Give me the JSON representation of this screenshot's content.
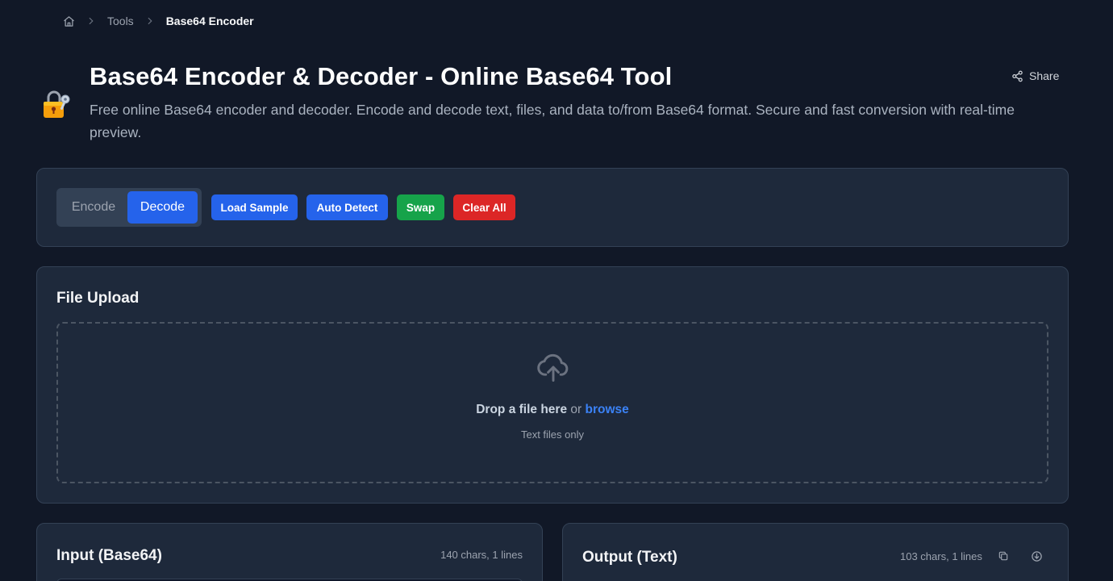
{
  "breadcrumb": {
    "home_icon": "home-icon",
    "items": [
      "Tools",
      "Base64 Encoder"
    ]
  },
  "header": {
    "icon": "lock-key-emoji",
    "title": "Base64 Encoder & Decoder - Online Base64 Tool",
    "description": "Free online Base64 encoder and decoder. Encode and decode text, files, and data to/from Base64 format. Secure and fast conversion with real-time preview.",
    "share_label": "Share"
  },
  "toolbar": {
    "modes": [
      "Encode",
      "Decode"
    ],
    "active_mode": "Decode",
    "load_sample": "Load Sample",
    "auto_detect": "Auto Detect",
    "swap": "Swap",
    "clear_all": "Clear All"
  },
  "upload": {
    "title": "File Upload",
    "drop_text": "Drop a file here",
    "or_text": "or",
    "browse_text": "browse",
    "hint": "Text files only"
  },
  "input_panel": {
    "title": "Input (Base64)",
    "stats": "140 chars, 1 lines"
  },
  "output_panel": {
    "title": "Output (Text)",
    "stats": "103 chars, 1 lines"
  },
  "colors": {
    "background": "#111827",
    "card": "#1e293b",
    "primary": "#2563eb",
    "success": "#16a34a",
    "danger": "#dc2626",
    "link": "#3b82f6"
  }
}
